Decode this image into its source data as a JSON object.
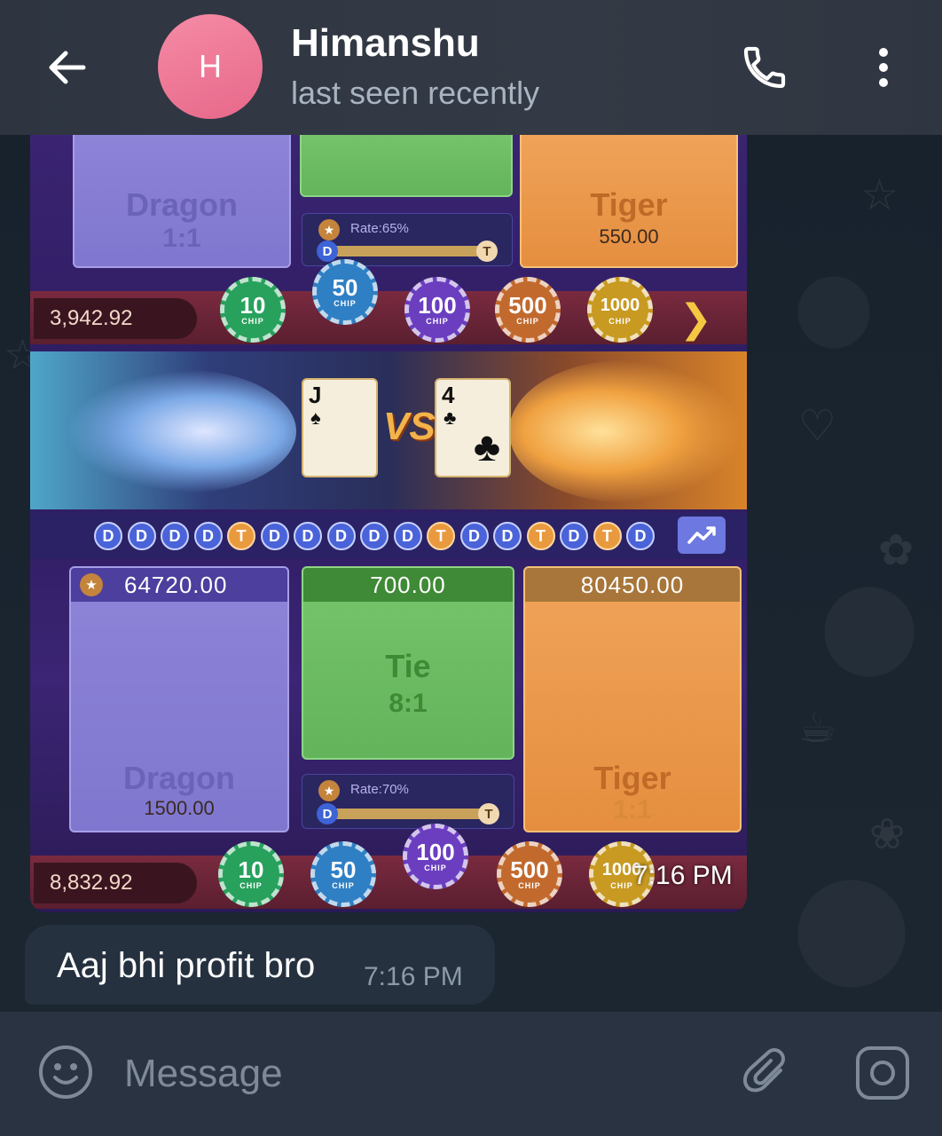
{
  "header": {
    "avatar_letter": "H",
    "contact_name": "Himanshu",
    "status": "last seen recently"
  },
  "image_message": {
    "time": "7:16 PM",
    "screenshot": {
      "top_panels": {
        "dragon": {
          "name": "Dragon",
          "odds": "1:1"
        },
        "tiger": {
          "name": "Tiger",
          "amount": "550.00"
        },
        "rate": "Rate:65%"
      },
      "top_balance": "3,942.92",
      "chips": [
        "10",
        "50",
        "100",
        "500",
        "1000"
      ],
      "chip_label": "CHIP",
      "cards": {
        "left": {
          "rank": "J",
          "suit": "♠"
        },
        "right": {
          "rank": "4",
          "suit": "♣"
        },
        "vs": "VS"
      },
      "history": [
        "D",
        "D",
        "D",
        "D",
        "T",
        "D",
        "D",
        "D",
        "D",
        "D",
        "T",
        "D",
        "D",
        "T",
        "D",
        "T",
        "D"
      ],
      "bottom_panels": {
        "dragon": {
          "bet": "64720.00",
          "name": "Dragon",
          "amount": "1500.00"
        },
        "tie": {
          "bet": "700.00",
          "name": "Tie",
          "odds": "8:1"
        },
        "tiger": {
          "bet": "80450.00",
          "name": "Tiger",
          "odds": "1:1"
        },
        "rate": "Rate:70%"
      },
      "bottom_balance": "8,832.92",
      "rate_d": "D",
      "rate_t": "T"
    }
  },
  "text_message": {
    "text": "Aaj bhi profit bro",
    "time": "7:16 PM"
  },
  "composer": {
    "placeholder": "Message"
  },
  "colors": {
    "header_bg": "#343a45",
    "chat_bg": "#1b2530",
    "bubble_bg": "#25313f",
    "composer_bg": "#2a3341",
    "avatar": "#ec7896"
  },
  "icons": {
    "back": "arrow-left-icon",
    "call": "phone-icon",
    "menu": "more-vertical-icon",
    "emoji": "smiley-icon",
    "attach": "paperclip-icon",
    "camera": "camera-icon"
  }
}
